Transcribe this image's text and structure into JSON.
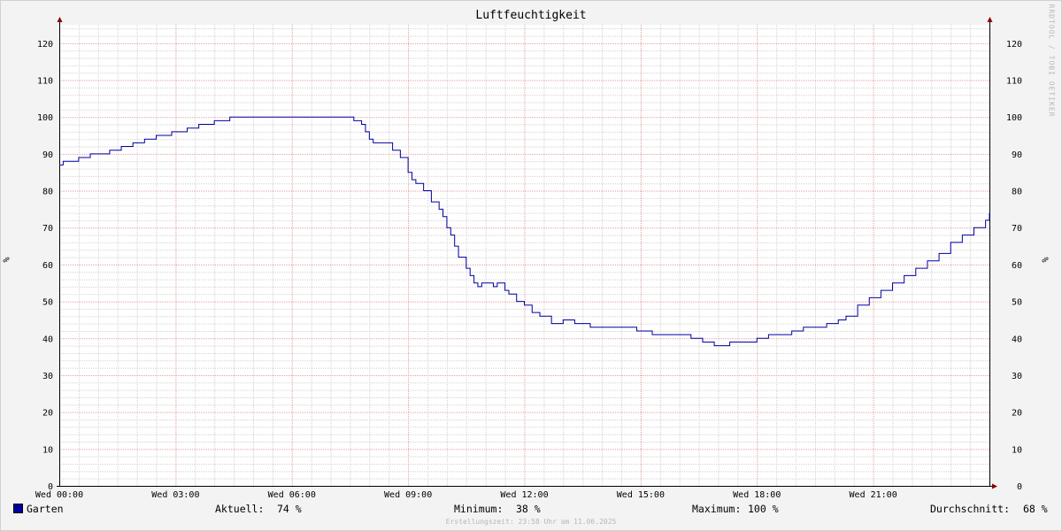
{
  "chart_data": {
    "type": "line",
    "title": "Luftfeuchtigkeit",
    "ylabel": "%",
    "ylim": [
      0,
      125
    ],
    "yticks": [
      0,
      10,
      20,
      30,
      40,
      50,
      60,
      70,
      80,
      90,
      100,
      110,
      120
    ],
    "xlim": [
      0,
      24
    ],
    "xticks": [
      {
        "hour": 0,
        "label": "Wed 00:00"
      },
      {
        "hour": 3,
        "label": "Wed 03:00"
      },
      {
        "hour": 6,
        "label": "Wed 06:00"
      },
      {
        "hour": 9,
        "label": "Wed 09:00"
      },
      {
        "hour": 12,
        "label": "Wed 12:00"
      },
      {
        "hour": 15,
        "label": "Wed 15:00"
      },
      {
        "hour": 18,
        "label": "Wed 18:00"
      },
      {
        "hour": 21,
        "label": "Wed 21:00"
      }
    ],
    "grid": true,
    "series": [
      {
        "name": "Garten",
        "color": "#0000a0",
        "x": [
          0,
          0.1,
          0.5,
          0.8,
          1.1,
          1.3,
          1.4,
          1.6,
          1.9,
          2.2,
          2.5,
          2.9,
          3.3,
          3.6,
          4.0,
          4.4,
          4.5,
          5.0,
          5.5,
          6.0,
          6.5,
          7.0,
          7.4,
          7.6,
          7.8,
          7.9,
          8.0,
          8.1,
          8.3,
          8.6,
          8.8,
          9.0,
          9.1,
          9.2,
          9.4,
          9.6,
          9.8,
          9.9,
          10.0,
          10.1,
          10.2,
          10.3,
          10.5,
          10.6,
          10.7,
          10.8,
          10.9,
          11.0,
          11.2,
          11.3,
          11.5,
          11.6,
          11.8,
          12.0,
          12.2,
          12.4,
          12.7,
          12.9,
          13.0,
          13.3,
          13.6,
          13.7,
          14.0,
          14.3,
          14.5,
          14.7,
          14.9,
          15.1,
          15.3,
          15.5,
          15.7,
          15.9,
          16.0,
          16.1,
          16.3,
          16.6,
          16.9,
          17.0,
          17.3,
          17.5,
          17.7,
          18.0,
          18.3,
          18.6,
          18.9,
          19.2,
          19.5,
          19.8,
          20.1,
          20.3,
          20.6,
          20.9,
          21.2,
          21.5,
          21.8,
          22.1,
          22.4,
          22.7,
          23.0,
          23.3,
          23.6,
          23.9,
          24.0
        ],
        "values": [
          87,
          88,
          89,
          90,
          90,
          91,
          91,
          92,
          93,
          94,
          95,
          96,
          97,
          98,
          99,
          100,
          100,
          100,
          100,
          100,
          100,
          100,
          100,
          99,
          98,
          96,
          94,
          93,
          93,
          91,
          89,
          85,
          83,
          82,
          80,
          77,
          75,
          73,
          70,
          68,
          65,
          62,
          59,
          57,
          55,
          54,
          55,
          55,
          54,
          55,
          53,
          52,
          50,
          49,
          47,
          46,
          44,
          44,
          45,
          44,
          44,
          43,
          43,
          43,
          43,
          43,
          42,
          42,
          41,
          41,
          41,
          41,
          41,
          41,
          40,
          39,
          38,
          38,
          39,
          39,
          39,
          40,
          41,
          41,
          42,
          43,
          43,
          44,
          45,
          46,
          49,
          51,
          53,
          55,
          57,
          59,
          61,
          63,
          66,
          68,
          70,
          72,
          74
        ]
      }
    ],
    "annotations": [
      "RRDTOOL / TOBI OETIKER"
    ]
  },
  "legend": {
    "series_name": "Garten",
    "current_label": "Aktuell:",
    "current_value": "74 %",
    "min_label": "Minimum:",
    "min_value": "38 %",
    "max_label": "Maximum:",
    "max_value": "100 %",
    "avg_label": "Durchschnitt:",
    "avg_value": "68 %"
  },
  "footer": "Erstellungszeit: 23:58 Uhr am 11.06.2025",
  "watermark": "RRDTOOL / TOBI OETIKER",
  "colors": {
    "line": "#0000a0",
    "grid_major": "#e69d9d",
    "grid_minor": "#d2d2d2",
    "axis": "#8b0000"
  }
}
